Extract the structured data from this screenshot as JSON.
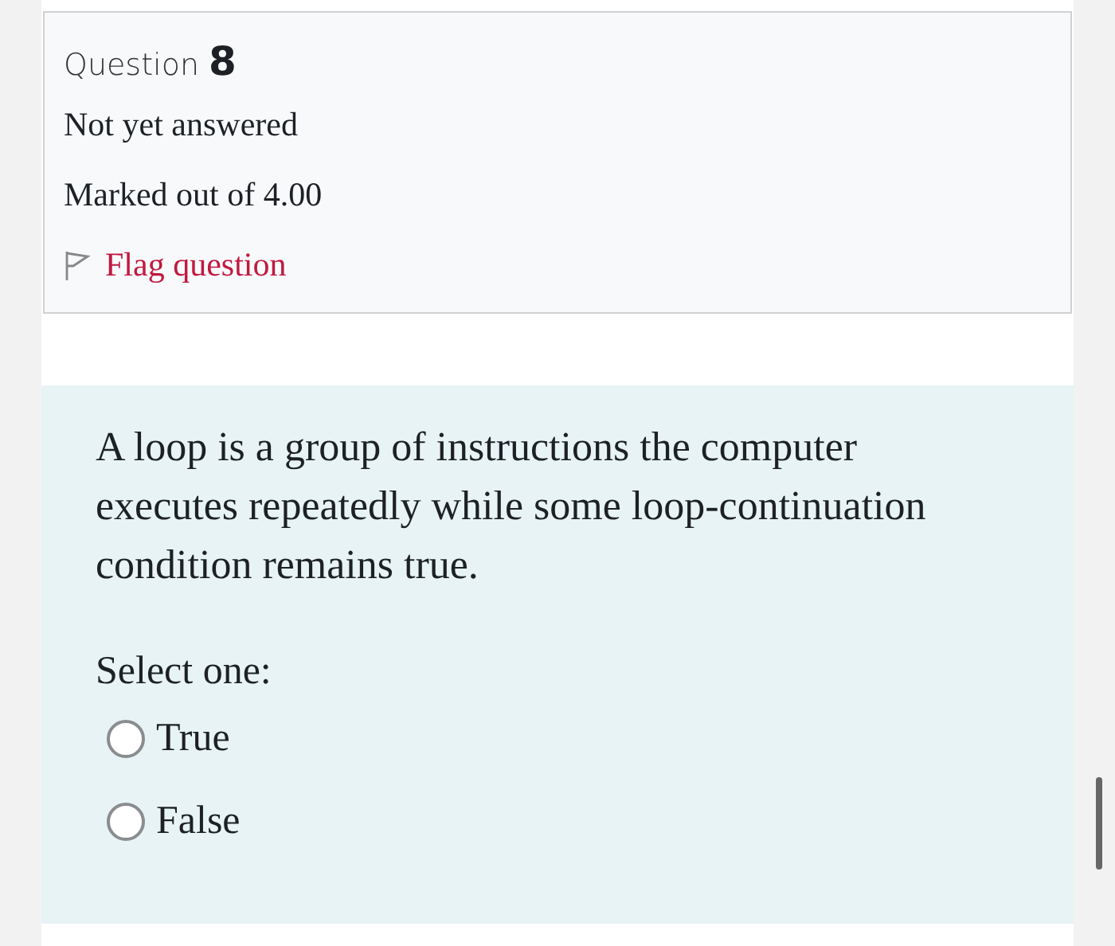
{
  "info": {
    "label": "Question",
    "number": "8",
    "state": "Not yet answered",
    "mark": "Marked out of 4.00",
    "flag": {
      "label": "Flag question",
      "flagged": false
    }
  },
  "formulation": {
    "text": "A loop is a group of instructions the computer executes repeatedly while some loop-continuation condition remains true.",
    "prompt": "Select one:",
    "options": [
      {
        "label": "True",
        "selected": false
      },
      {
        "label": "False",
        "selected": false
      }
    ]
  }
}
